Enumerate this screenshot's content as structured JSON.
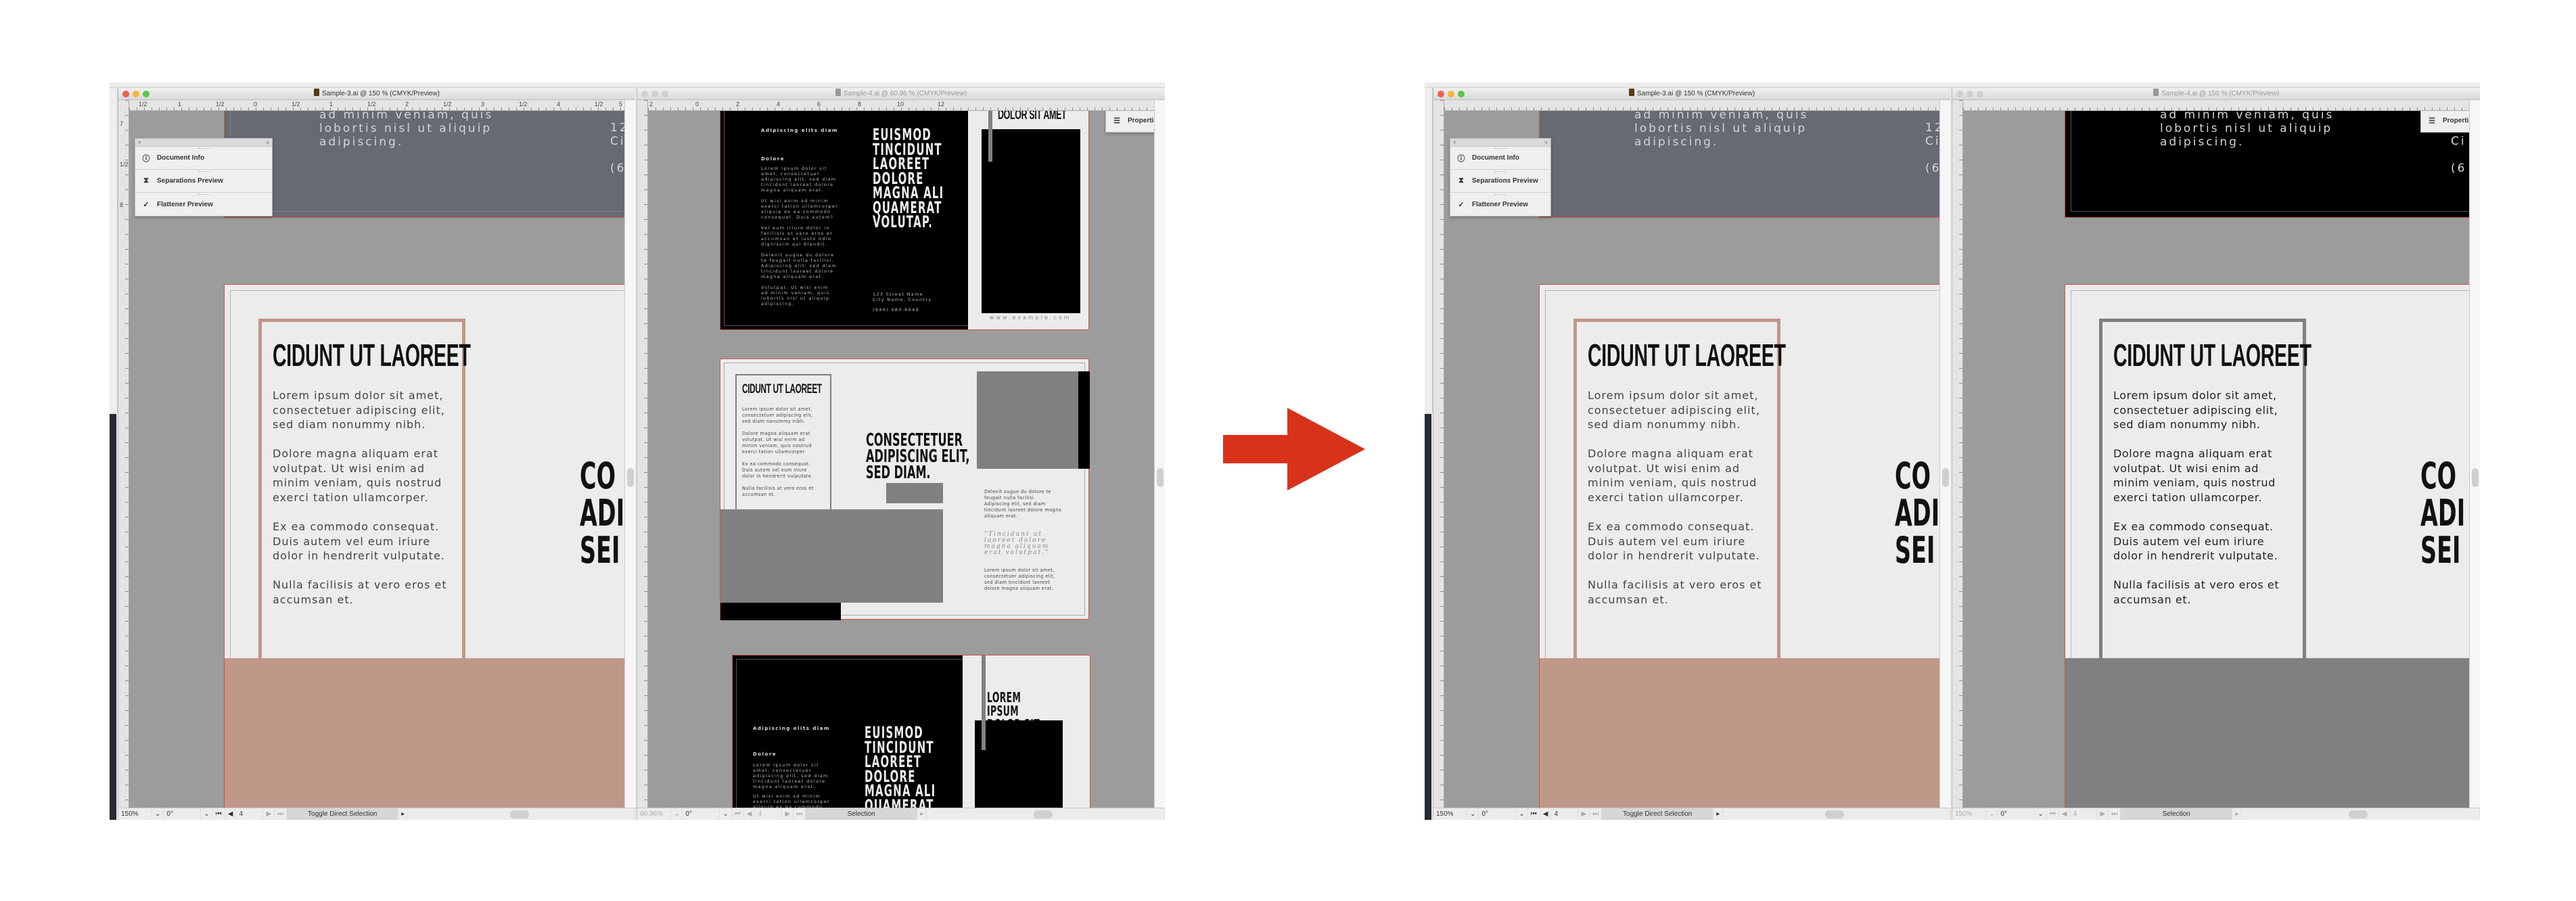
{
  "arrow": {
    "color": "#d9321b"
  },
  "colors": {
    "accent_before": "#c0988a",
    "accent_after": "#808080",
    "dark_before": "#676a73",
    "dark_after": "#000000",
    "artboard_bg": "#ececec",
    "pasteboard": "#9c9c9c",
    "artboard_border": "#c9573f"
  },
  "before": {
    "window1": {
      "title": "Sample-3.ai @ 150 % (CMYK/Preview)",
      "ruler_h": [
        "1/2",
        "1",
        "1/2",
        "0",
        "1/2",
        "1",
        "1/2",
        "2",
        "1/2",
        "3",
        "1/2",
        "4",
        "1/2",
        "5"
      ],
      "ruler_v": [
        "7",
        "1/2",
        "8"
      ],
      "panel": {
        "close": "×",
        "collapse": "»",
        "items": [
          {
            "label": "Document Info",
            "icon": "document-info-icon"
          },
          {
            "label": "Separations Preview",
            "icon": "separations-preview-icon"
          },
          {
            "label": "Flattener Preview",
            "icon": "flattener-preview-icon"
          }
        ]
      },
      "top_text": "ad minim veniam, quis\nlobortis nisl ut aliquip\nadipiscing.",
      "top_right_text": "12\nCi\n\n(6",
      "heading": "CIDUNT UT LAOREET",
      "paragraphs": [
        "Lorem ipsum dolor sit amet,\nconsectetuer adipiscing elit,\nsed diam nonummy nibh.",
        "Dolore magna aliquam erat\nvolutpat. Ut wisi enim ad\nminim veniam, quis nostrud\nexerci tation ullamcorper.",
        "Ex ea commodo consequat.\nDuis autem vel eum iriure\ndolor in hendrerit vulputate.",
        "Nulla facilisis at vero eros et\naccumsan et."
      ],
      "side_heading": "CO\nADI\nSEI",
      "status": {
        "zoom": "150%",
        "rotation": "0°",
        "artboard": "4",
        "tool": "Toggle Direct Selection"
      }
    },
    "window2": {
      "title": "Sample-4.ai @ 60.96 % (CMYK/Preview)",
      "ruler_h": [
        "2",
        "0",
        "2",
        "4",
        "6",
        "8",
        "10",
        "12"
      ],
      "properties_label": "Properties",
      "ab1": {
        "small_heading": "Adipiscing elits diam",
        "sub": "Dolore",
        "paras": [
          "Lorem ipsum dolor sit\namet, consectetuer\nadipiscing elit, sed diam\ntincidunt laoreet dolore\nmagna aliquam erat.",
          "Ut wisi enim ad minim\nexerci tation ullamcorper\naliquip ex ea commodo\nconsequat. Duis autem?",
          "Vel eum iriure dolor in\nfacilisis at vero eros et\naccumsan et iusto odio\ndignissim qui blandit.",
          "Delenit augue du dolore\nte feugait nulla facilisi.\nAdipiscing elit, sed diam\ntincidunt laoreet dolore\nmagna aliquam erat.",
          "Volutpat. Ut wisi enim\nad minim veniam, quis\nlobortis nisl ut aliquip\nadipiscing."
        ],
        "big": "EUISMOD\nTINCIDUNT\nLAOREET\nDOLORE\nMAGNA ALI\nQUAMERAT\nVOLUTAP.",
        "address": "123 Street Name\nCity Name, Country",
        "phone": "(646) 480-6649",
        "cover_title": "DOLOR SIT AMET",
        "url": "www.example.com"
      },
      "ab2": {
        "heading": "CIDUNT UT LAOREET",
        "paras": "Lorem ipsum dolor sit amet,\nconsectetuer adipiscing elit,\nsed diam nonummy nibh.\n\nDolore magna aliquam erat\nvolutpat. Ut wisi enim ad\nminim veniam, quis nostrud\nexerci tation ullamcorper.\n\nEx ea commodo consequat.\nDuis autem vel eum iriure\ndolor in hendrerit vulputate.\n\nNulla facilisis at vero eros et\naccumsan et.",
        "center_heading": "CONSECTETUER\nADIPISCING ELIT,\nSED DIAM.",
        "right_para1": "Delenit augue du dolore te\nfeugait nulla facilisi.\nAdipiscing elit, sed diam\ntincidunt laoreet dolore magna\naliquam erat.",
        "quote": "\"Tincidunt ut\nlaoreet dolore\nmagna aliquam\nerat volutpat.\"",
        "right_para2": "Lorem ipsum dolor sit amet,\nconsectetuer adipiscing elit,\nsed diam tincidunt laoreet\ndolore magna aliquam erat."
      },
      "ab3": {
        "cover_title": "LOREM IPSUM\nDOLOR SIT AMET"
      },
      "status": {
        "zoom": "60.96%",
        "rotation": "0°",
        "artboard": "4",
        "tool": "Selection"
      }
    }
  },
  "after": {
    "window1": {
      "title": "Sample-3.ai @ 150 % (CMYK/Preview)",
      "status": {
        "zoom": "150%",
        "rotation": "0°",
        "artboard": "4",
        "tool": "Toggle Direct Selection"
      }
    },
    "window2": {
      "title": "Sample-4.ai @ 150 % (CMYK/Preview)",
      "properties_label": "Properties",
      "status": {
        "zoom": "150%",
        "rotation": "0°",
        "artboard": "4",
        "tool": "Selection"
      }
    }
  }
}
